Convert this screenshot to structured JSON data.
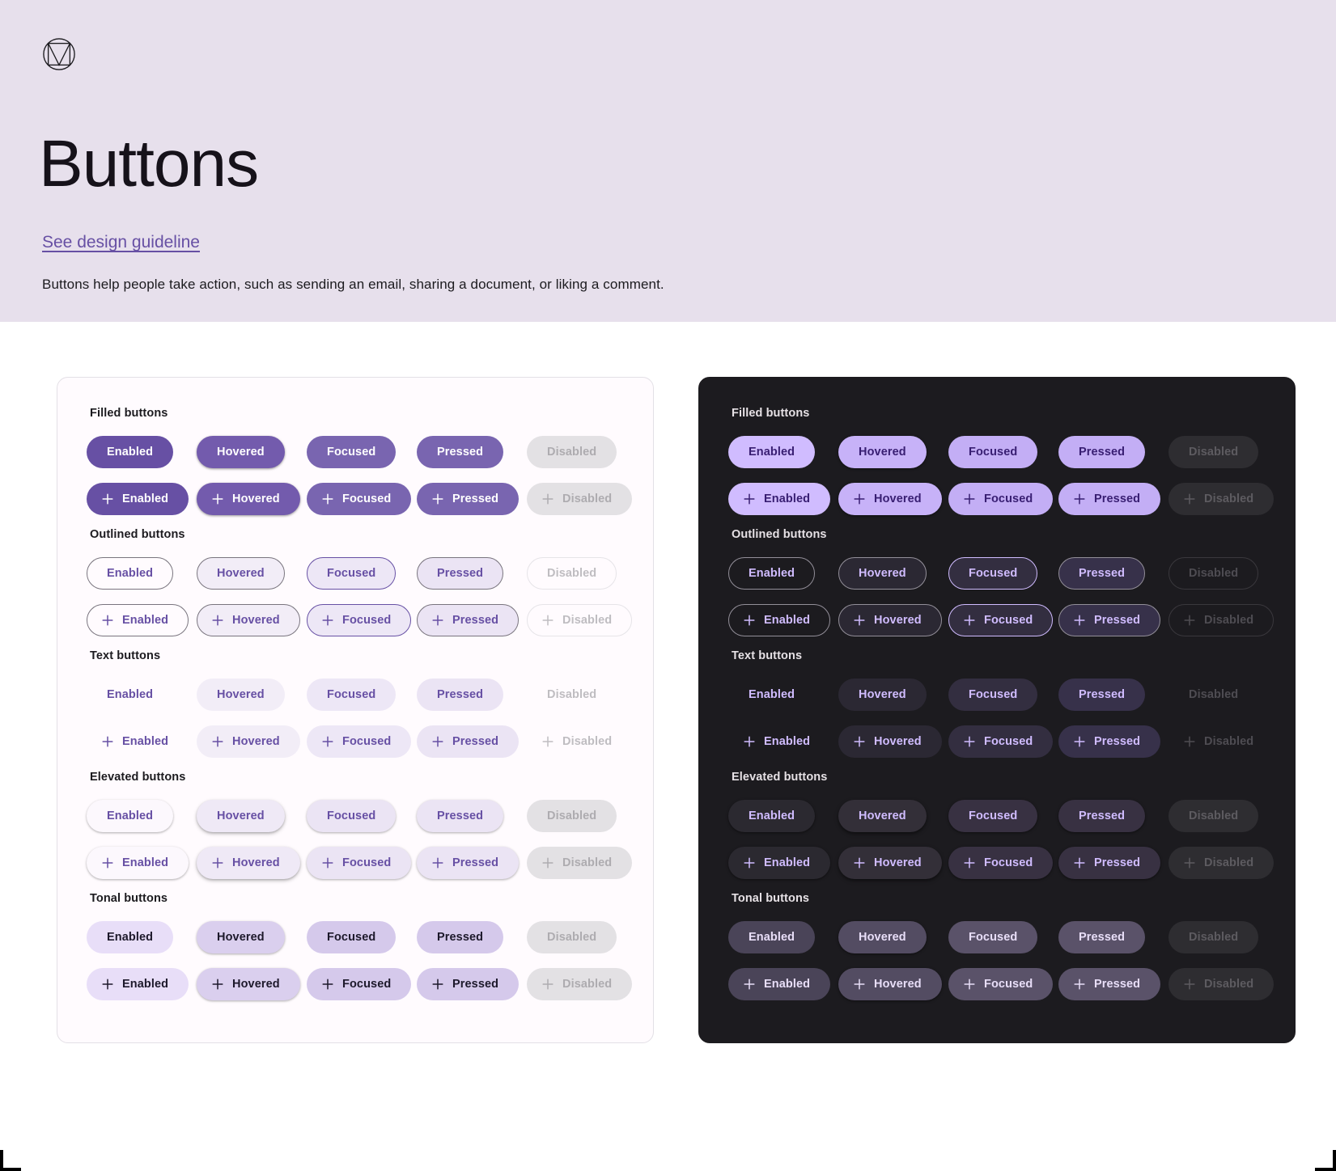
{
  "header": {
    "logo_icon": "material-design-logo-icon",
    "title": "Buttons",
    "link_label": "See design guideline",
    "description": "Buttons help people take action, such as sending an email, sharing a document, or liking a comment.",
    "background_color": "#E7E0EC",
    "link_color": "#6750A4"
  },
  "states": [
    "Enabled",
    "Hovered",
    "Focused",
    "Pressed",
    "Disabled"
  ],
  "groups": [
    {
      "id": "filled",
      "title": "Filled buttons"
    },
    {
      "id": "outlined",
      "title": "Outlined buttons"
    },
    {
      "id": "text",
      "title": "Text buttons"
    },
    {
      "id": "elevated",
      "title": "Elevated buttons"
    },
    {
      "id": "tonal",
      "title": "Tonal buttons"
    }
  ],
  "icon": {
    "name": "plus-icon",
    "glyph": "+"
  },
  "panels": [
    {
      "id": "light-theme-panel",
      "theme": "light",
      "surface_color": "#FFFBFE",
      "border_color": "#E3E0E6",
      "accent_color": "#6750A4",
      "groups": [
        {
          "id": "filled",
          "title": "Filled buttons"
        },
        {
          "id": "outlined",
          "title": "Outlined buttons"
        },
        {
          "id": "text",
          "title": "Text buttons"
        },
        {
          "id": "elevated",
          "title": "Elevated buttons"
        },
        {
          "id": "tonal",
          "title": "Tonal buttons"
        }
      ]
    },
    {
      "id": "dark-theme-panel",
      "theme": "dark",
      "surface_color": "#1C1B1F",
      "border_color": "#1C1B1F",
      "accent_color": "#D0BCFF",
      "groups": [
        {
          "id": "filled",
          "title": "Filled buttons"
        },
        {
          "id": "outlined",
          "title": "Outlined buttons"
        },
        {
          "id": "text",
          "title": "Text buttons"
        },
        {
          "id": "elevated",
          "title": "Elevated buttons"
        },
        {
          "id": "tonal",
          "title": "Tonal buttons"
        }
      ]
    }
  ]
}
